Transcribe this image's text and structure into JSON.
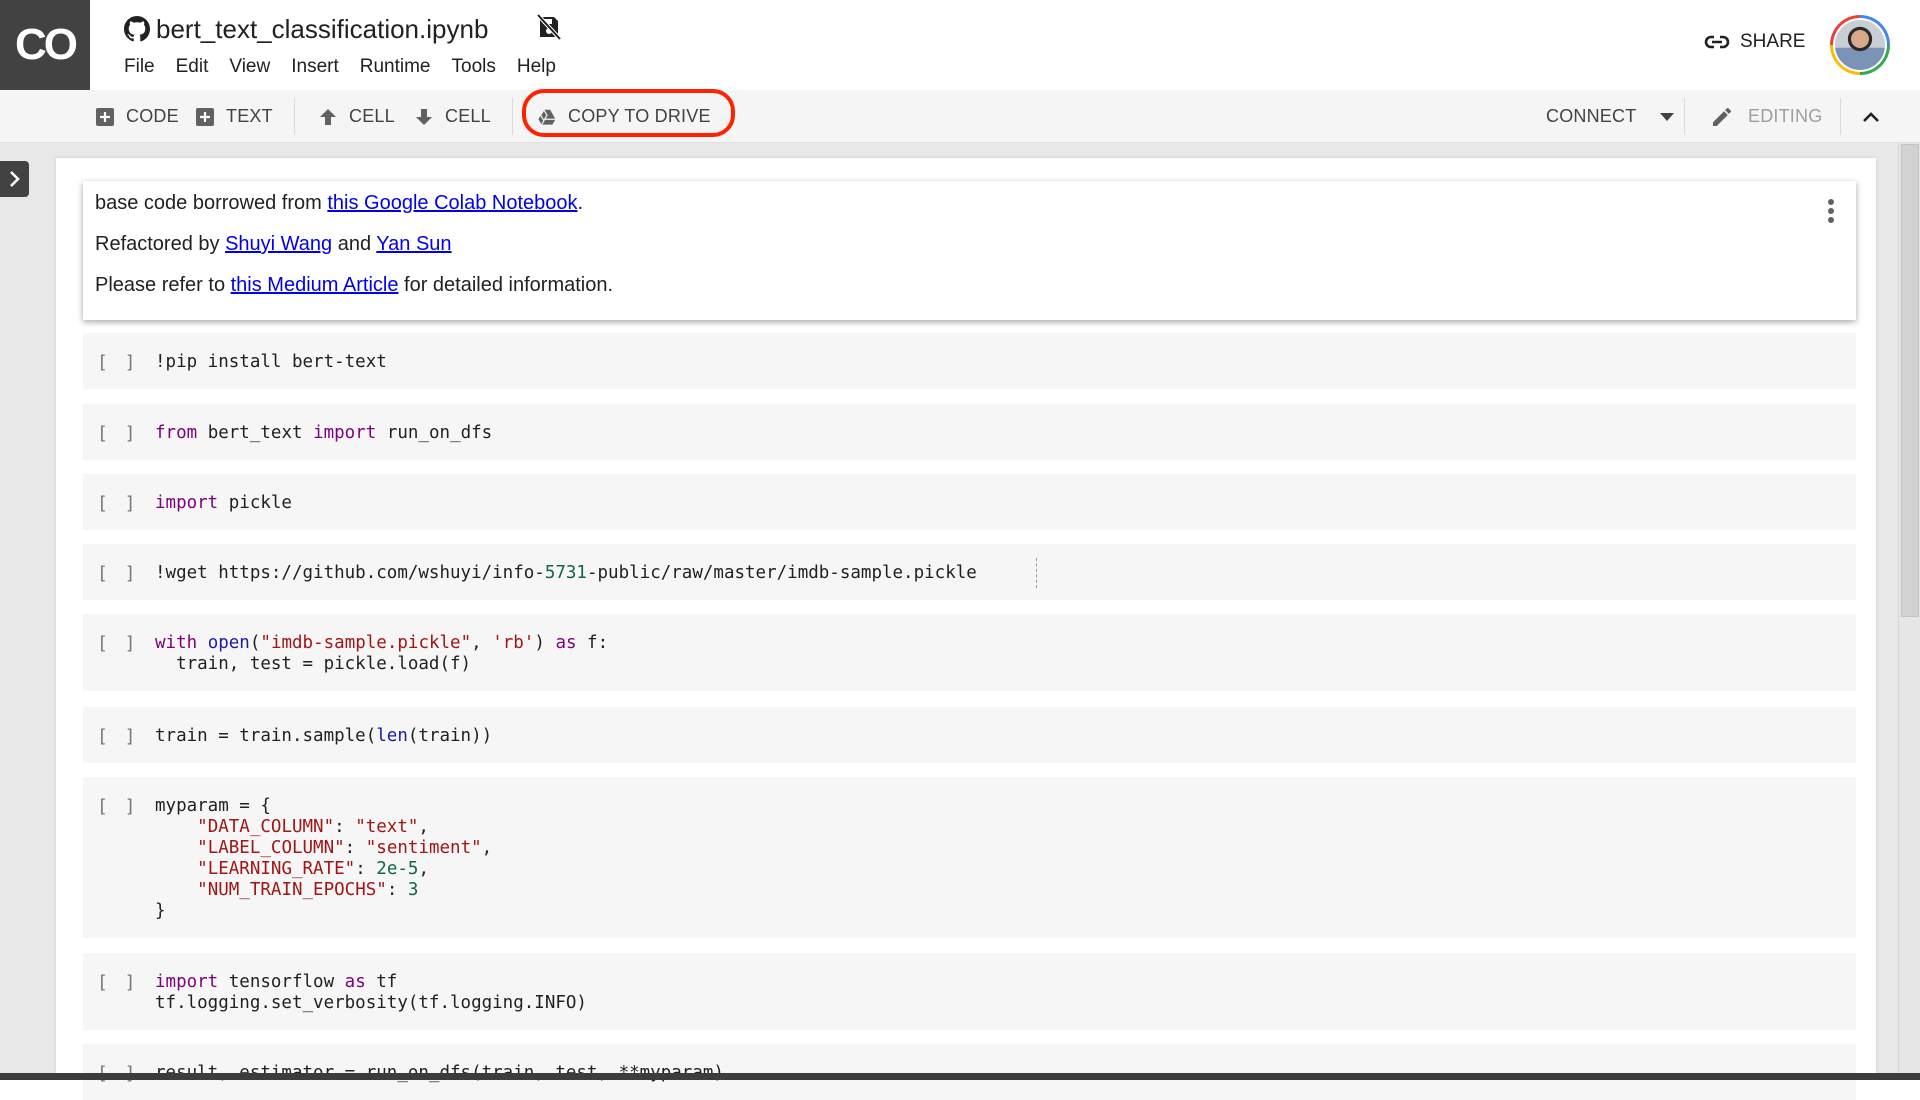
{
  "header": {
    "logo_text": "CO",
    "notebook_title": "bert_text_classification.ipynb",
    "source_icon": "github-icon",
    "save_status_icon": "no-save-icon",
    "menu": [
      "File",
      "Edit",
      "View",
      "Insert",
      "Runtime",
      "Tools",
      "Help"
    ],
    "share_label": "SHARE",
    "accent_colors": {
      "highlight_ring": "#ff2200",
      "logo_bg": "#424242"
    }
  },
  "toolbar": {
    "add_code_label": "CODE",
    "add_text_label": "TEXT",
    "cell_up_label": "CELL",
    "cell_down_label": "CELL",
    "copy_to_drive_label": "COPY TO DRIVE",
    "connect_label": "CONNECT",
    "editing_label": "EDITING"
  },
  "text_cell": {
    "line1_prefix": "base code borrowed from ",
    "line1_link": "this Google Colab Notebook",
    "line1_suffix": ".",
    "line2_prefix": "Refactored by ",
    "line2_link1": "Shuyi Wang",
    "line2_mid": " and ",
    "line2_link2": "Yan Sun",
    "line3_prefix": "Please refer to ",
    "line3_link": "this Medium Article",
    "line3_suffix": " for detailed information."
  },
  "code_cells": [
    {
      "run_label": "[ ]",
      "code": "!pip install bert-text"
    },
    {
      "run_label": "[ ]",
      "code": "from bert_text import run_on_dfs"
    },
    {
      "run_label": "[ ]",
      "code": "import pickle"
    },
    {
      "run_label": "[ ]",
      "code": "!wget https://github.com/wshuyi/info-5731-public/raw/master/imdb-sample.pickle"
    },
    {
      "run_label": "[ ]",
      "code": "with open(\"imdb-sample.pickle\", 'rb') as f:\n  train, test = pickle.load(f)"
    },
    {
      "run_label": "[ ]",
      "code": "train = train.sample(len(train))"
    },
    {
      "run_label": "[ ]",
      "code": "myparam = {\n    \"DATA_COLUMN\": \"text\",\n    \"LABEL_COLUMN\": \"sentiment\",\n    \"LEARNING_RATE\": 2e-5,\n    \"NUM_TRAIN_EPOCHS\": 3\n}"
    },
    {
      "run_label": "[ ]",
      "code": "import tensorflow as tf\ntf.logging.set_verbosity(tf.logging.INFO)"
    },
    {
      "run_label": "[ ]",
      "code": "result, estimator = run_on_dfs(train, test, **myparam)"
    }
  ]
}
